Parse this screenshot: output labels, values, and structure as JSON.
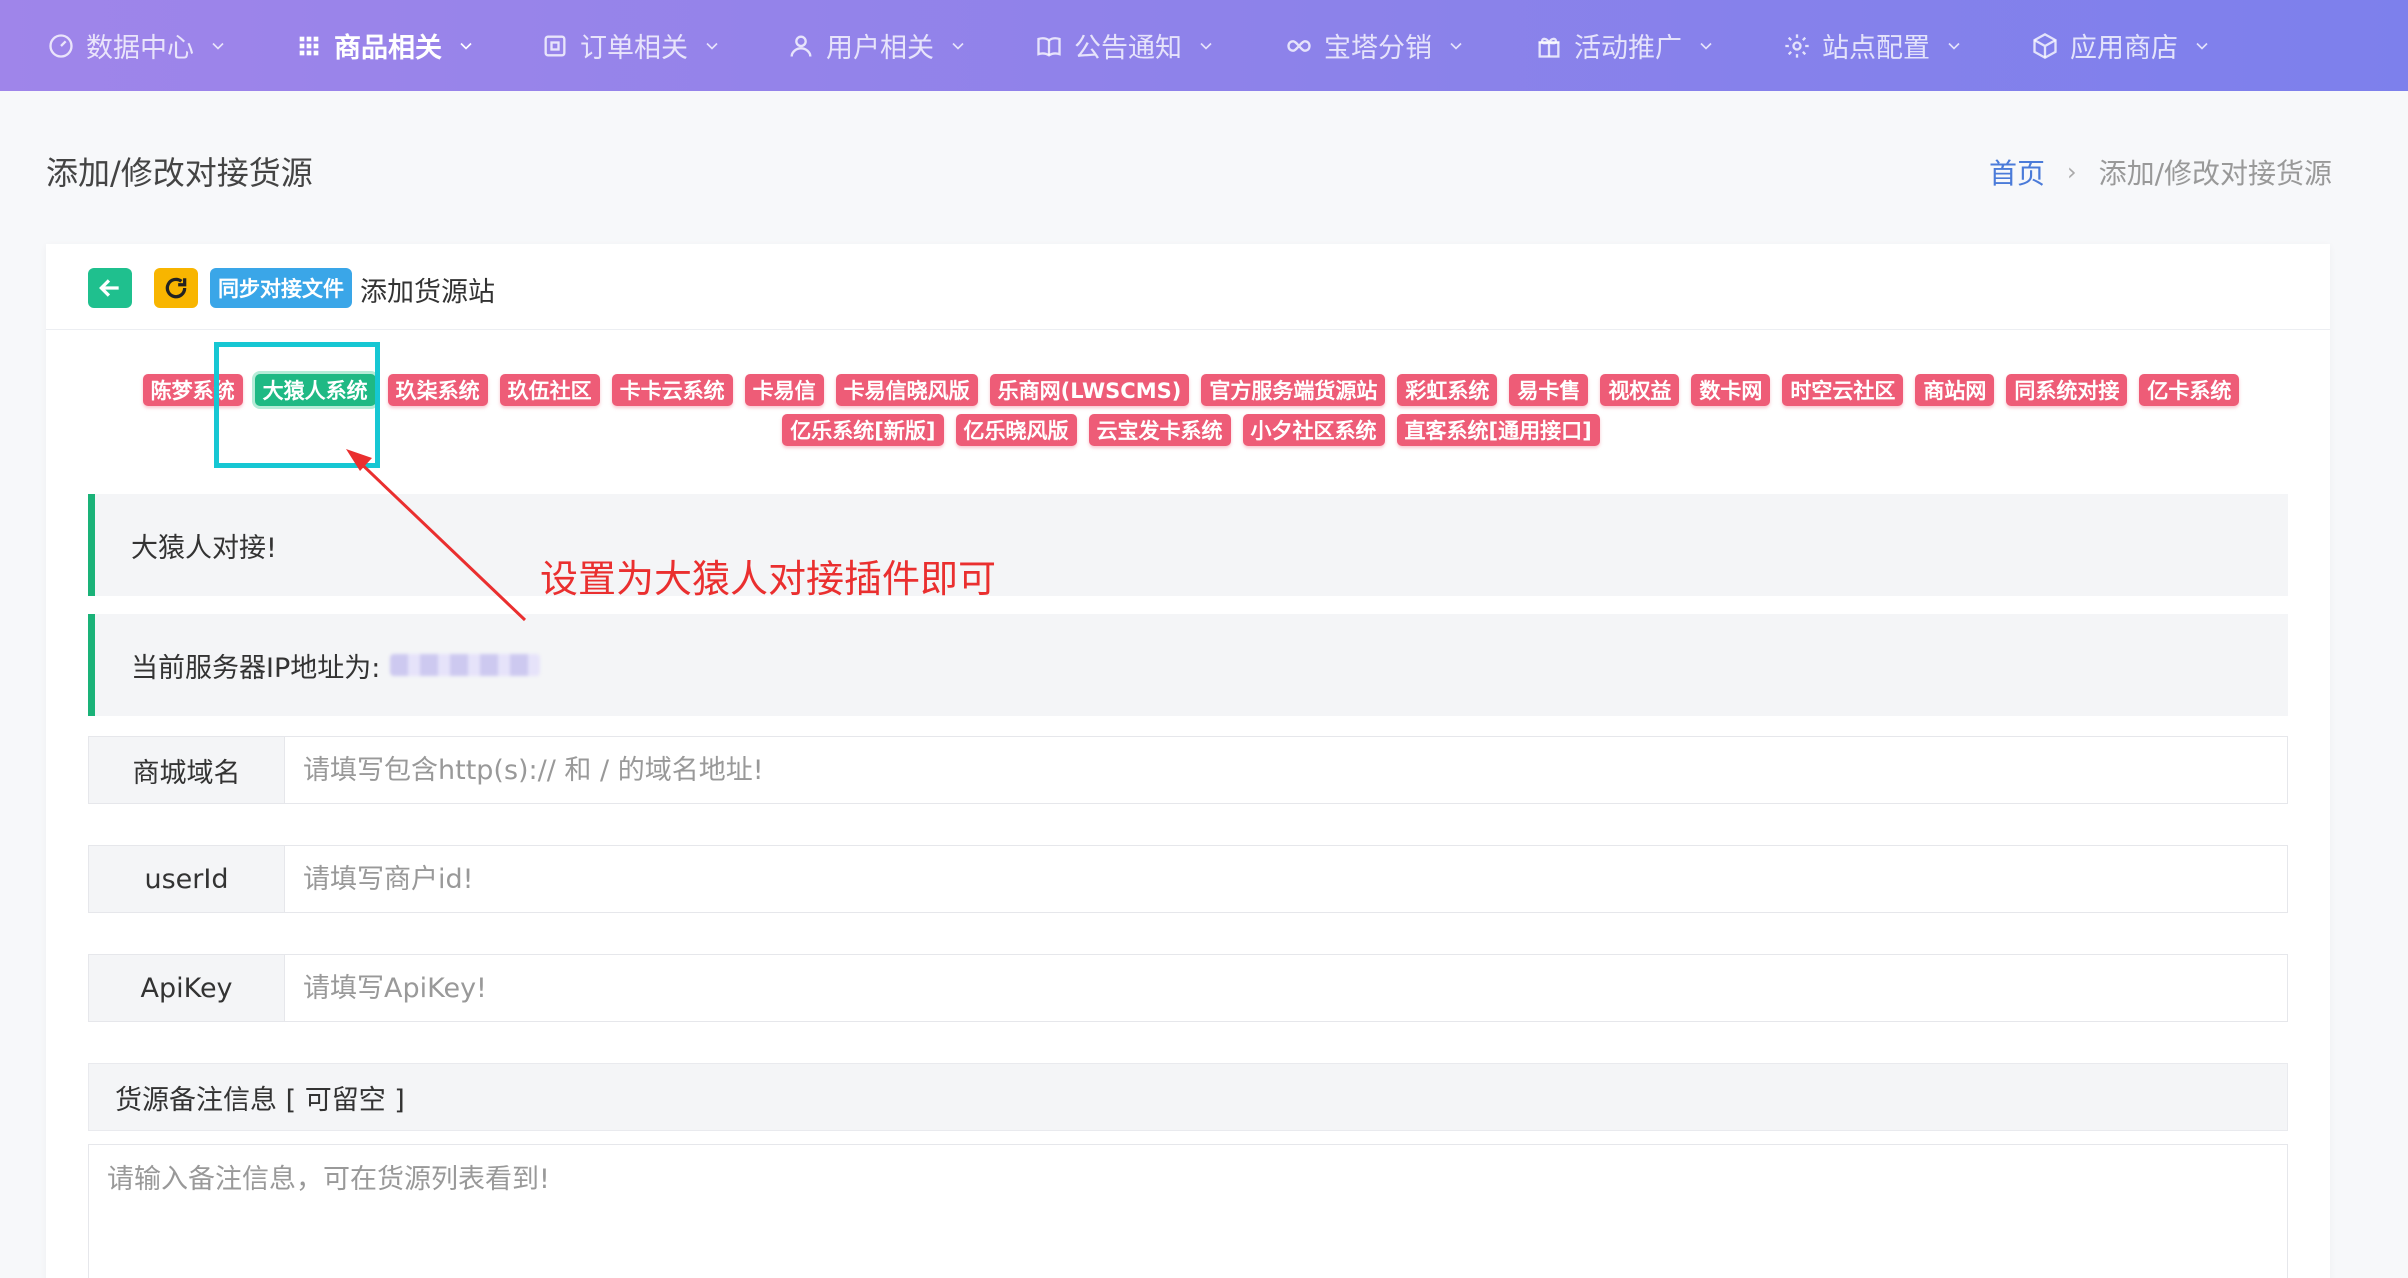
{
  "nav": {
    "items": [
      {
        "label": "数据中心",
        "icon": "dashboard-icon"
      },
      {
        "label": "商品相关",
        "icon": "grid-icon"
      },
      {
        "label": "订单相关",
        "icon": "order-icon"
      },
      {
        "label": "用户相关",
        "icon": "user-icon"
      },
      {
        "label": "公告通知",
        "icon": "book-icon"
      },
      {
        "label": "宝塔分销",
        "icon": "infinity-icon"
      },
      {
        "label": "活动推广",
        "icon": "gift-icon"
      },
      {
        "label": "站点配置",
        "icon": "gear-icon"
      },
      {
        "label": "应用商店",
        "icon": "box-icon"
      }
    ]
  },
  "header": {
    "title": "添加/修改对接货源",
    "breadcrumb_home": "首页",
    "breadcrumb_sep": "›",
    "breadcrumb_current": "添加/修改对接货源"
  },
  "card": {
    "sync_label": "同步对接文件",
    "title": "添加货源站"
  },
  "plugins": {
    "row1": [
      "陈梦系统",
      "大猿人系统",
      "玖柒系统",
      "玖伍社区",
      "卡卡云系统",
      "卡易信",
      "卡易信晓风版",
      "乐商网(LWSCMS)",
      "官方服务端货源站",
      "彩虹系统",
      "易卡售",
      "视权益",
      "数卡网",
      "时空云社区",
      "商站网",
      "同系统对接",
      "亿卡系统"
    ],
    "row2": [
      "亿乐系统[新版]",
      "亿乐晓风版",
      "云宝发卡系统",
      "小夕社区系统",
      "直客系统[通用接口]"
    ],
    "selected": "大猿人系统"
  },
  "annotation": {
    "text": "设置为大猿人对接插件即可"
  },
  "notices": {
    "plugin_notice": "大猿人对接!",
    "ip_label": "当前服务器IP地址为:"
  },
  "form": {
    "domain_label": "商城域名",
    "domain_placeholder": "请填写包含http(s):// 和 / 的域名地址!",
    "userid_label": "userId",
    "userid_placeholder": "请填写商户id!",
    "apikey_label": "ApiKey",
    "apikey_placeholder": "请填写ApiKey!",
    "note_header": "货源备注信息 [ 可留空 ]",
    "note_placeholder": "请输入备注信息，可在货源列表看到!"
  },
  "colors": {
    "nav_gradient_start": "#9f85ea",
    "nav_gradient_end": "#7d80ec",
    "tag_red": "#ee5c77",
    "tag_selected": "#1fb984",
    "annotation_red": "#ea2f2f",
    "highlight_cyan": "#16c7d3",
    "notice_border": "#1ab278"
  }
}
